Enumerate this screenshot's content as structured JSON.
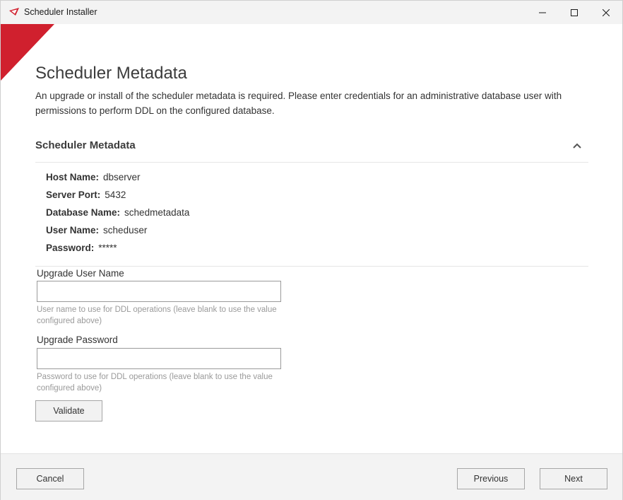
{
  "window": {
    "title": "Scheduler Installer",
    "accent_color": "#d0202e"
  },
  "titlebar": {
    "minimize_icon": "minimize-icon",
    "maximize_icon": "maximize-icon",
    "close_icon": "close-icon"
  },
  "header": {
    "title": "Scheduler Metadata",
    "description": "An upgrade or install of the scheduler metadata is required. Please enter credentials for an administrative database user with permissions to perform DDL on the configured database."
  },
  "section": {
    "title": "Scheduler Metadata",
    "collapse_icon": "chevron-up-icon",
    "info": [
      {
        "label": "Host Name:",
        "value": "dbserver"
      },
      {
        "label": "Server Port:",
        "value": "5432"
      },
      {
        "label": "Database Name:",
        "value": "schedmetadata"
      },
      {
        "label": "User Name:",
        "value": "scheduser"
      },
      {
        "label": "Password:",
        "value": "*****"
      }
    ]
  },
  "form": {
    "upgrade_user": {
      "label": "Upgrade User Name",
      "value": "",
      "help": "User name to use for DDL operations (leave blank to use the value configured above)"
    },
    "upgrade_password": {
      "label": "Upgrade Password",
      "value": "",
      "help": "Password to use for DDL operations (leave blank to use the value configured above)"
    },
    "validate_label": "Validate"
  },
  "footer": {
    "cancel_label": "Cancel",
    "previous_label": "Previous",
    "next_label": "Next"
  }
}
